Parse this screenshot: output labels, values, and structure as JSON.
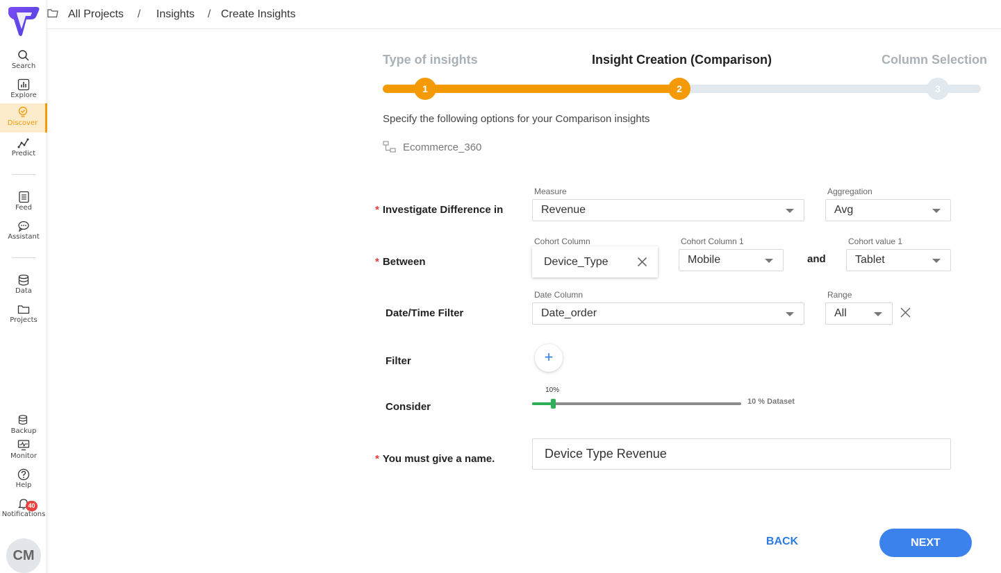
{
  "sidebar": {
    "items": [
      {
        "label": "Search"
      },
      {
        "label": "Explore"
      },
      {
        "label": "Discover"
      },
      {
        "label": "Predict"
      },
      {
        "label": "Feed"
      },
      {
        "label": "Assistant"
      },
      {
        "label": "Data"
      },
      {
        "label": "Projects"
      }
    ],
    "bottom_items": [
      {
        "label": "Backup"
      },
      {
        "label": "Monitor"
      },
      {
        "label": "Help"
      },
      {
        "label": "Notifications"
      }
    ],
    "notification_count": "40",
    "avatar_initials": "CM",
    "accent_color": "#f59a07"
  },
  "breadcrumb": {
    "items": [
      "All Projects",
      "Insights",
      "Create Insights"
    ],
    "separator": "/"
  },
  "stepper": {
    "steps": [
      {
        "label": "Type of insights",
        "number": "1",
        "state": "done"
      },
      {
        "label": "Insight Creation (Comparison)",
        "number": "2",
        "state": "active"
      },
      {
        "label": "Column Selection",
        "number": "3",
        "state": "pending"
      }
    ],
    "active_color": "#f59a07",
    "inactive_color": "#e1e8ee"
  },
  "form": {
    "description": "Specify the following options for your Comparison insights",
    "dataset_name": "Ecommerce_360",
    "investigate": {
      "label": "Investigate Difference in",
      "measure_label": "Measure",
      "measure_value": "Revenue",
      "aggregation_label": "Aggregation",
      "aggregation_value": "Avg"
    },
    "between": {
      "label": "Between",
      "cohort_column_label": "Cohort Column",
      "cohort_column_value": "Device_Type",
      "cohort_column1_label": "Cohort Column 1",
      "cohort_column1_value": "Mobile",
      "and_label": "and",
      "cohort_value1_label": "Cohort value 1",
      "cohort_value1_value": "Tablet"
    },
    "date_filter": {
      "label": "Date/Time Filter",
      "date_column_label": "Date Column",
      "date_column_value": "Date_order",
      "range_label": "Range",
      "range_value": "All"
    },
    "filter": {
      "label": "Filter",
      "add_symbol": "+"
    },
    "consider": {
      "label": "Consider",
      "slider_percent": 10,
      "value_text": "10%",
      "dataset_text": "10 % Dataset"
    },
    "name": {
      "label": "You must give a name.",
      "value": "Device Type Revenue"
    }
  },
  "actions": {
    "back_label": "BACK",
    "next_label": "NEXT"
  }
}
